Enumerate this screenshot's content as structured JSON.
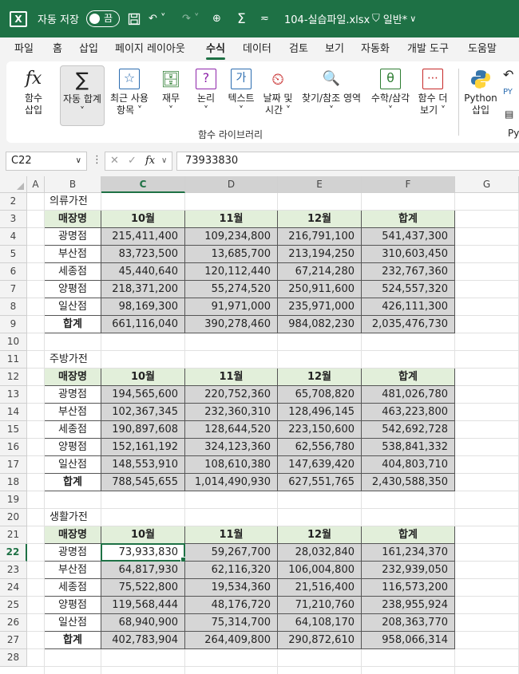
{
  "titlebar": {
    "autosave_label": "자동 저장",
    "autosave_state": "끔",
    "filename": "104-실습파일.xlsx",
    "sensitivity": "일반*"
  },
  "menu": [
    "파일",
    "홈",
    "삽입",
    "페이지 레이아웃",
    "수식",
    "데이터",
    "검토",
    "보기",
    "자동화",
    "개발 도구",
    "도움말"
  ],
  "ribbon": {
    "insert_function": [
      "함수",
      "삽입"
    ],
    "autosum": [
      "자동 합계"
    ],
    "recent": [
      "최근 사용",
      "항목"
    ],
    "financial": [
      "재무"
    ],
    "logical": [
      "논리"
    ],
    "text": [
      "텍스트"
    ],
    "datetime": [
      "날짜 및",
      "시간"
    ],
    "lookup": [
      "찾기/참조 영역"
    ],
    "math": [
      "수학/삼각"
    ],
    "more": [
      "함수 더",
      "보기"
    ],
    "python": [
      "Python",
      "삽입"
    ],
    "group_label": "함수 라이브러리",
    "py_tail": "Pyt"
  },
  "formula_bar": {
    "name_box": "C22",
    "fx_label": "fx",
    "value": "73933830"
  },
  "columns": [
    "A",
    "B",
    "C",
    "D",
    "E",
    "F",
    "G"
  ],
  "rows": [
    "2",
    "3",
    "4",
    "5",
    "6",
    "7",
    "8",
    "9",
    "10",
    "11",
    "12",
    "13",
    "14",
    "15",
    "16",
    "17",
    "18",
    "19",
    "20",
    "21",
    "22",
    "23",
    "24",
    "25",
    "26",
    "27",
    "28"
  ],
  "table_headers": [
    "매장명",
    "10월",
    "11월",
    "12월",
    "합계"
  ],
  "sections": [
    {
      "title": "의류가전",
      "rows": [
        [
          "광명점",
          "215,411,400",
          "109,234,800",
          "216,791,100",
          "541,437,300"
        ],
        [
          "부산점",
          "83,723,500",
          "13,685,700",
          "213,194,250",
          "310,603,450"
        ],
        [
          "세종점",
          "45,440,640",
          "120,112,440",
          "67,214,280",
          "232,767,360"
        ],
        [
          "양평점",
          "218,371,200",
          "55,274,520",
          "250,911,600",
          "524,557,320"
        ],
        [
          "일산점",
          "98,169,300",
          "91,971,000",
          "235,971,000",
          "426,111,300"
        ],
        [
          "합계",
          "661,116,040",
          "390,278,460",
          "984,082,230",
          "2,035,476,730"
        ]
      ]
    },
    {
      "title": "주방가전",
      "rows": [
        [
          "광명점",
          "194,565,600",
          "220,752,360",
          "65,708,820",
          "481,026,780"
        ],
        [
          "부산점",
          "102,367,345",
          "232,360,310",
          "128,496,145",
          "463,223,800"
        ],
        [
          "세종점",
          "190,897,608",
          "128,644,520",
          "223,150,600",
          "542,692,728"
        ],
        [
          "양평점",
          "152,161,192",
          "324,123,360",
          "62,556,780",
          "538,841,332"
        ],
        [
          "일산점",
          "148,553,910",
          "108,610,380",
          "147,639,420",
          "404,803,710"
        ],
        [
          "합계",
          "788,545,655",
          "1,014,490,930",
          "627,551,765",
          "2,430,588,350"
        ]
      ]
    },
    {
      "title": "생활가전",
      "rows": [
        [
          "광명점",
          "73,933,830",
          "59,267,700",
          "28,032,840",
          "161,234,370"
        ],
        [
          "부산점",
          "64,817,930",
          "62,116,320",
          "106,004,800",
          "232,939,050"
        ],
        [
          "세종점",
          "75,522,800",
          "19,534,360",
          "21,516,400",
          "116,573,200"
        ],
        [
          "양평점",
          "119,568,444",
          "48,176,720",
          "71,210,760",
          "238,955,924"
        ],
        [
          "일산점",
          "68,940,900",
          "75,314,700",
          "64,108,170",
          "208,363,770"
        ],
        [
          "합계",
          "402,783,904",
          "264,409,800",
          "290,872,610",
          "958,066,314"
        ]
      ]
    }
  ],
  "colors": {
    "excel_green": "#1e7145",
    "header_fill": "#e2efda",
    "value_fill": "#d6d6d6"
  }
}
